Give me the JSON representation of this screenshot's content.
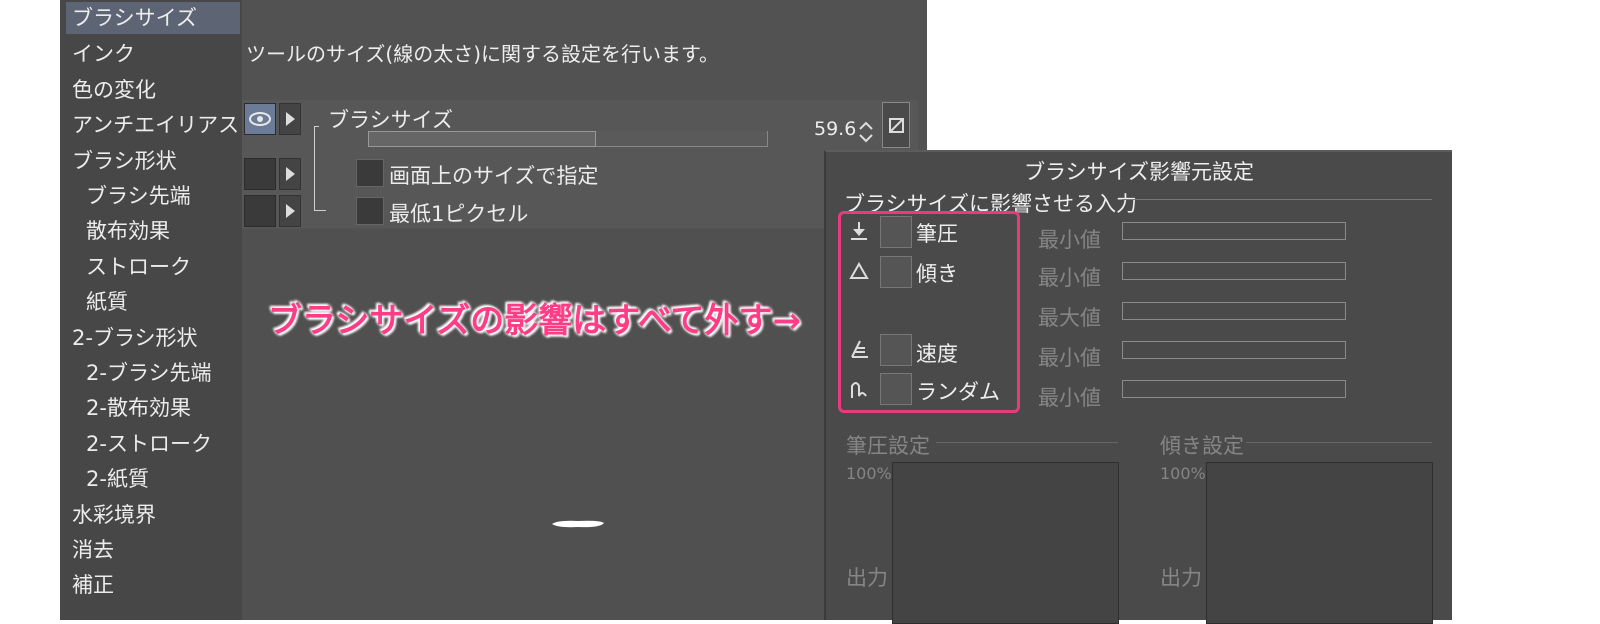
{
  "categories": [
    {
      "label": "ブラシサイズ",
      "selected": true
    },
    {
      "label": "インク"
    },
    {
      "label": "色の変化"
    },
    {
      "label": "アンチエイリアス"
    },
    {
      "label": "ブラシ形状"
    },
    {
      "label": "ブラシ先端",
      "indent": true
    },
    {
      "label": "散布効果",
      "indent": true
    },
    {
      "label": "ストローク",
      "indent": true
    },
    {
      "label": "紙質",
      "indent": true
    },
    {
      "label": "2-ブラシ形状"
    },
    {
      "label": "2-ブラシ先端",
      "indent": true
    },
    {
      "label": "2-散布効果",
      "indent": true
    },
    {
      "label": "2-ストローク",
      "indent": true
    },
    {
      "label": "2-紙質",
      "indent": true
    },
    {
      "label": "水彩境界"
    },
    {
      "label": "消去"
    },
    {
      "label": "補正"
    }
  ],
  "description": "ツールのサイズ(線の太さ)に関する設定を行います。",
  "settings": {
    "brush_size_label": "ブラシサイズ",
    "brush_size_value": "59.6",
    "brush_size_fill_pct": 57,
    "screen_size_label": "画面上のサイズで指定",
    "min_1px_label": "最低1ピクセル"
  },
  "dialog": {
    "title": "ブラシサイズ影響元設定",
    "section_label": "ブラシサイズに影響させる入力",
    "inputs": [
      {
        "label": "筆圧",
        "icon": "pen-pressure-icon",
        "value_label": "最小値"
      },
      {
        "label": "傾き",
        "icon": "tilt-icon",
        "value_label": "最小値"
      },
      {
        "label": "",
        "icon": "",
        "value_label": "最大値"
      },
      {
        "label": "速度",
        "icon": "velocity-icon",
        "value_label": "最小値"
      },
      {
        "label": "ランダム",
        "icon": "random-icon",
        "value_label": "最小値"
      }
    ],
    "pressure_settings_label": "筆圧設定",
    "tilt_settings_label": "傾き設定",
    "percent_label": "100%",
    "output_label": "出力"
  },
  "annotation": "ブラシサイズの影響はすべて外す→",
  "colors": {
    "annotation": "#ff3d86",
    "highlight_border": "#e63c7c"
  }
}
